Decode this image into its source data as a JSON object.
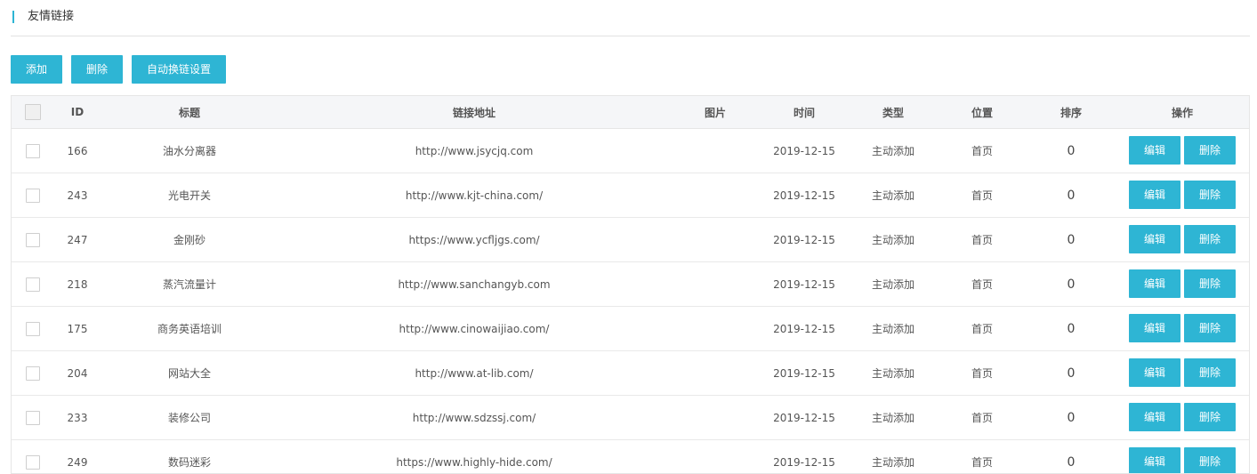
{
  "page": {
    "title": "友情链接"
  },
  "toolbar": {
    "add": "添加",
    "delete": "删除",
    "auto_link": "自动换链设置"
  },
  "columns": [
    "ID",
    "标题",
    "链接地址",
    "图片",
    "时间",
    "类型",
    "位置",
    "排序",
    "操作"
  ],
  "actions": {
    "edit": "编辑",
    "delete": "删除"
  },
  "rows": [
    {
      "id": "166",
      "title": "油水分离器",
      "url": "http://www.jsycjq.com",
      "image": "",
      "time": "2019-12-15",
      "type": "主动添加",
      "position": "首页",
      "sort": "0"
    },
    {
      "id": "243",
      "title": "光电开关",
      "url": "http://www.kjt-china.com/",
      "image": "",
      "time": "2019-12-15",
      "type": "主动添加",
      "position": "首页",
      "sort": "0"
    },
    {
      "id": "247",
      "title": "金刚砂",
      "url": "https://www.ycfljgs.com/",
      "image": "",
      "time": "2019-12-15",
      "type": "主动添加",
      "position": "首页",
      "sort": "0"
    },
    {
      "id": "218",
      "title": "蒸汽流量计",
      "url": "http://www.sanchangyb.com",
      "image": "",
      "time": "2019-12-15",
      "type": "主动添加",
      "position": "首页",
      "sort": "0"
    },
    {
      "id": "175",
      "title": "商务英语培训",
      "url": "http://www.cinowaijiao.com/",
      "image": "",
      "time": "2019-12-15",
      "type": "主动添加",
      "position": "首页",
      "sort": "0"
    },
    {
      "id": "204",
      "title": "网站大全",
      "url": "http://www.at-lib.com/",
      "image": "",
      "time": "2019-12-15",
      "type": "主动添加",
      "position": "首页",
      "sort": "0"
    },
    {
      "id": "233",
      "title": "装修公司",
      "url": "http://www.sdzssj.com/",
      "image": "",
      "time": "2019-12-15",
      "type": "主动添加",
      "position": "首页",
      "sort": "0"
    },
    {
      "id": "249",
      "title": "数码迷彩",
      "url": "https://www.highly-hide.com/",
      "image": "",
      "time": "2019-12-15",
      "type": "主动添加",
      "position": "首页",
      "sort": "0"
    }
  ]
}
